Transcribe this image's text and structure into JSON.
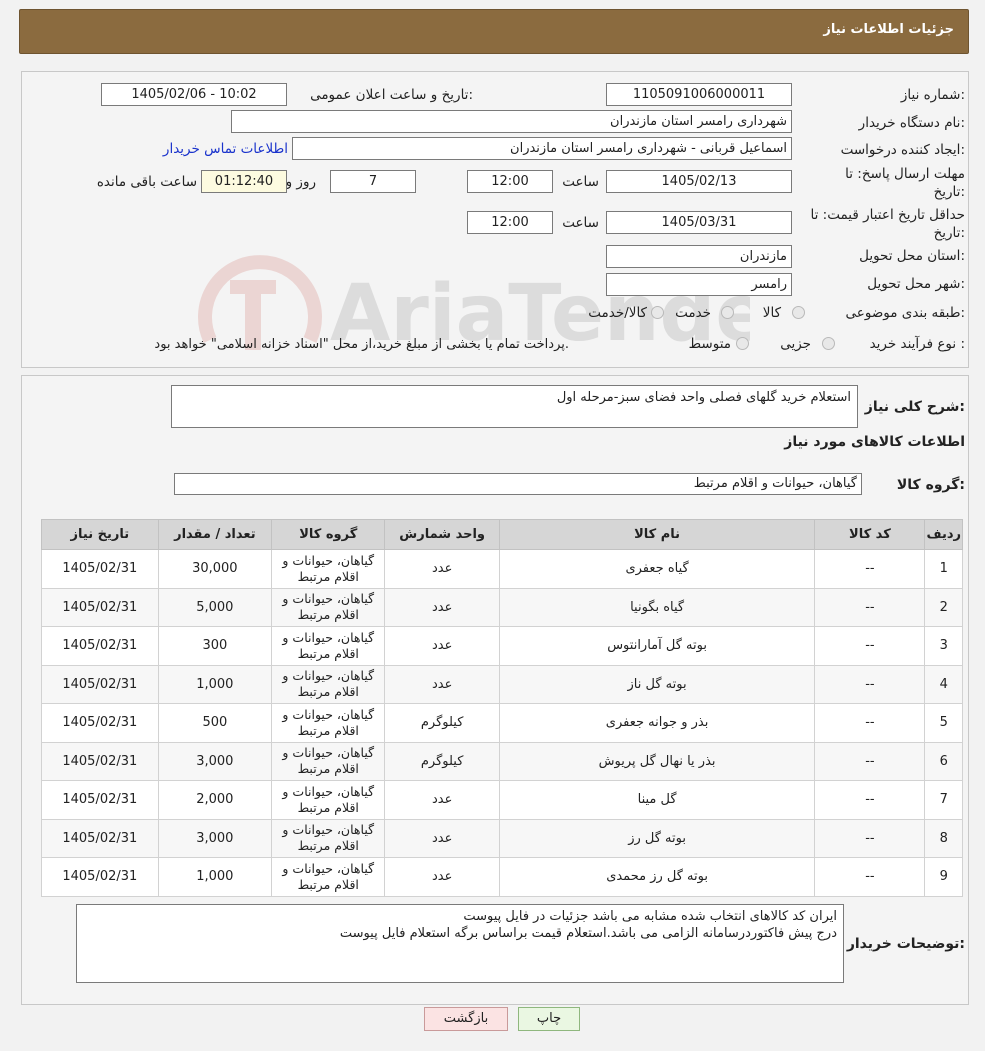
{
  "header": {
    "title": "جزئیات اطلاعات نیاز"
  },
  "watermark": {
    "text": "AriaTender.neT"
  },
  "form": {
    "need_number_label": "شماره نیاز:",
    "need_number": "1105091006000011",
    "announce_label": "تاریخ و ساعت اعلان عمومی:",
    "announce_value": "1405/02/06 - 10:02",
    "buyer_org_label": "نام دستگاه خریدار:",
    "buyer_org": "شهرداری رامسر استان مازندران",
    "requester_label": "ایجاد کننده درخواست:",
    "requester": "اسماعیل قربانی - شهرداری رامسر استان مازندران",
    "contact_link": "اطلاعات تماس خریدار",
    "reply_deadline_label": "مهلت ارسال پاسخ: تا تاریخ:",
    "reply_date": "1405/02/13",
    "time_label": "ساعت",
    "reply_time": "12:00",
    "days_value": "7",
    "days_label": "روز و",
    "remaining_time": "01:12:40",
    "remaining_label": "ساعت باقی مانده",
    "price_validity_label": "حداقل تاریخ اعتبار قیمت: تا تاریخ:",
    "validity_date": "1405/03/31",
    "validity_time": "12:00",
    "province_label": "استان محل تحویل:",
    "province": "مازندران",
    "city_label": "شهر محل تحویل:",
    "city": "رامسر",
    "category_label": "طبقه بندی موضوعی:",
    "category_options": [
      "کالا",
      "خدمت",
      "کالا/خدمت"
    ],
    "process_label": "نوع فرآیند خرید :",
    "process_options": [
      "جزیی",
      "متوسط"
    ],
    "process_note": "پرداخت تمام یا بخشی از مبلغ خرید،از محل \"اسناد خزانه اسلامی\" خواهد بود."
  },
  "details": {
    "summary_label": "شرح کلی نیاز:",
    "summary": "استعلام خرید گلهای فصلی واحد فضای سبز-مرحله اول",
    "goods_info_title": "اطلاعات کالاهای مورد نیاز",
    "group_label": "گروه کالا:",
    "group_value": "گیاهان، حیوانات و اقلام مرتبط"
  },
  "table": {
    "headers": [
      "ردیف",
      "کد کالا",
      "نام کالا",
      "واحد شمارش",
      "گروه کالا",
      "تعداد / مقدار",
      "تاریخ نیاز"
    ],
    "rows": [
      [
        "1",
        "--",
        "گیاه جعفری",
        "عدد",
        "گیاهان، حیوانات و اقلام مرتبط",
        "30,000",
        "1405/02/31"
      ],
      [
        "2",
        "--",
        "گیاه بگونیا",
        "عدد",
        "گیاهان، حیوانات و اقلام مرتبط",
        "5,000",
        "1405/02/31"
      ],
      [
        "3",
        "--",
        "بوته گل آمارانتوس",
        "عدد",
        "گیاهان، حیوانات و اقلام مرتبط",
        "300",
        "1405/02/31"
      ],
      [
        "4",
        "--",
        "بوته گل ناز",
        "عدد",
        "گیاهان، حیوانات و اقلام مرتبط",
        "1,000",
        "1405/02/31"
      ],
      [
        "5",
        "--",
        "بذر و جوانه جعفری",
        "کیلوگرم",
        "گیاهان، حیوانات و اقلام مرتبط",
        "500",
        "1405/02/31"
      ],
      [
        "6",
        "--",
        "بذر یا نهال گل پریوش",
        "کیلوگرم",
        "گیاهان، حیوانات و اقلام مرتبط",
        "3,000",
        "1405/02/31"
      ],
      [
        "7",
        "--",
        "گل مینا",
        "عدد",
        "گیاهان، حیوانات و اقلام مرتبط",
        "2,000",
        "1405/02/31"
      ],
      [
        "8",
        "--",
        "بوته گل رز",
        "عدد",
        "گیاهان، حیوانات و اقلام مرتبط",
        "3,000",
        "1405/02/31"
      ],
      [
        "9",
        "--",
        "بوته گل رز محمدی",
        "عدد",
        "گیاهان، حیوانات و اقلام مرتبط",
        "1,000",
        "1405/02/31"
      ]
    ]
  },
  "buyer_notes": {
    "label": "توضیحات خریدار:",
    "text": "ایران کد کالاهای انتخاب شده مشابه می باشد جزئیات در فایل پیوست\nدرج پیش فاکتوردرسامانه الزامی می باشد.استعلام قیمت براساس برگه استعلام فایل پیوست"
  },
  "buttons": {
    "print": "چاپ",
    "back": "بازگشت"
  }
}
